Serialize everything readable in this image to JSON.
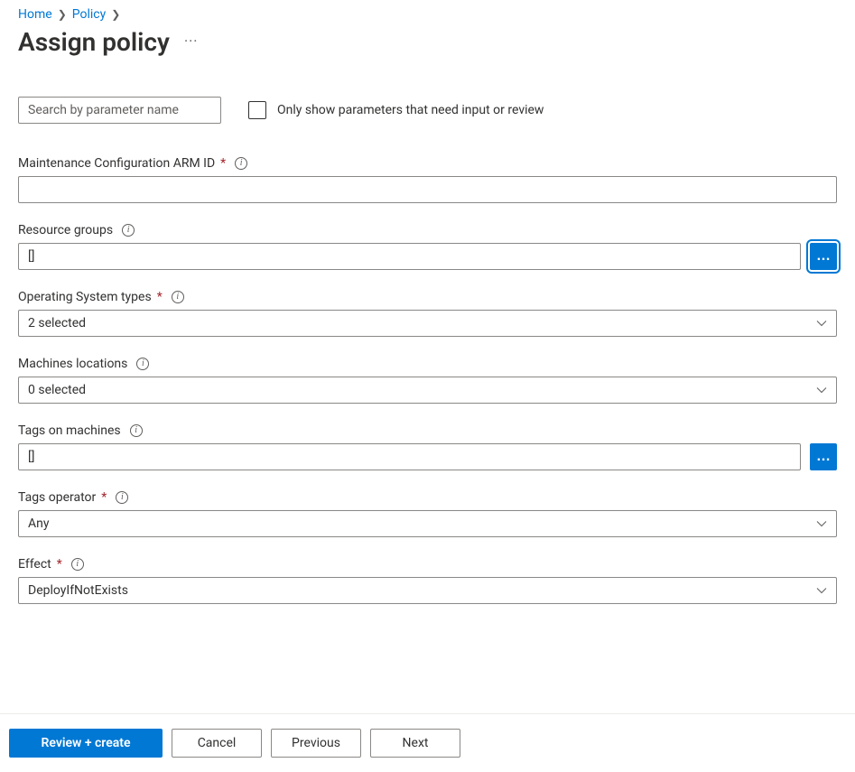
{
  "breadcrumb": {
    "items": [
      "Home",
      "Policy"
    ]
  },
  "page": {
    "title": "Assign policy"
  },
  "filter": {
    "search_placeholder": "Search by parameter name",
    "checkbox_label": "Only show parameters that need input or review"
  },
  "fields": {
    "maintenance": {
      "label": "Maintenance Configuration ARM ID",
      "required": true,
      "value": ""
    },
    "resource_groups": {
      "label": "Resource groups",
      "required": false,
      "value": "[]"
    },
    "os_types": {
      "label": "Operating System types",
      "required": true,
      "value": "2 selected"
    },
    "locations": {
      "label": "Machines locations",
      "required": false,
      "value": "0 selected"
    },
    "tags": {
      "label": "Tags on machines",
      "required": false,
      "value": "[]"
    },
    "tags_operator": {
      "label": "Tags operator",
      "required": true,
      "value": "Any"
    },
    "effect": {
      "label": "Effect",
      "required": true,
      "value": "DeployIfNotExists"
    }
  },
  "footer": {
    "review": "Review + create",
    "cancel": "Cancel",
    "previous": "Previous",
    "next": "Next"
  }
}
